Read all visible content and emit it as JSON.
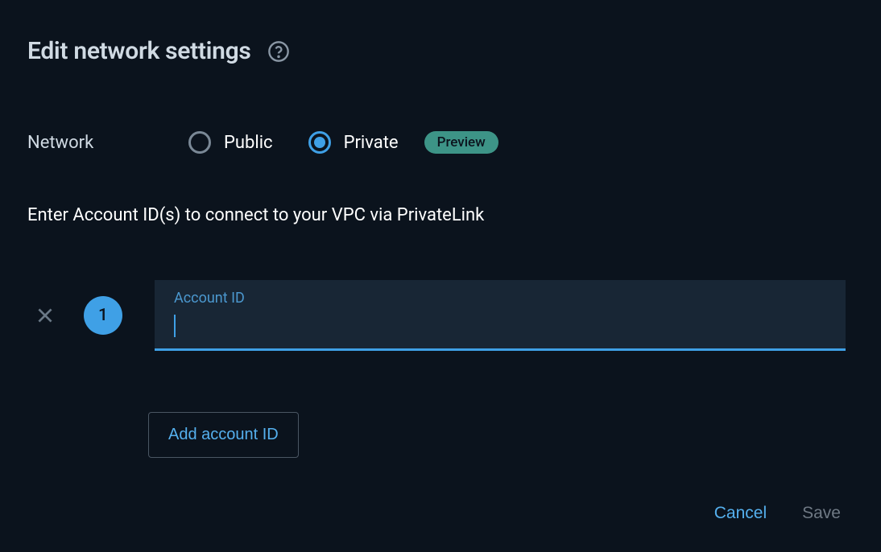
{
  "header": {
    "title": "Edit network settings"
  },
  "network": {
    "label": "Network",
    "options": {
      "public": "Public",
      "private": "Private"
    },
    "preview_badge": "Preview"
  },
  "instruction": "Enter Account ID(s) to connect to your VPC via PrivateLink",
  "account_rows": [
    {
      "number": "1",
      "field_label": "Account ID",
      "value": ""
    }
  ],
  "buttons": {
    "add_account": "Add account ID",
    "cancel": "Cancel",
    "save": "Save"
  }
}
